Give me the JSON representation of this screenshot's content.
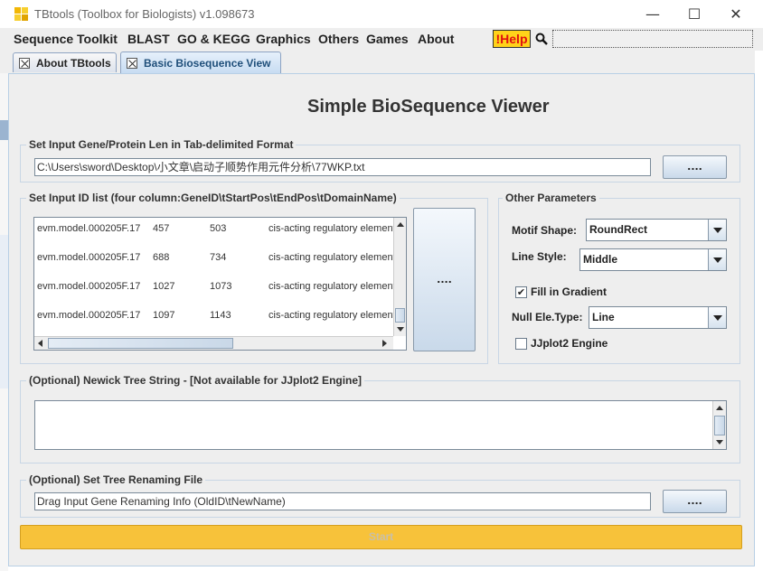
{
  "window": {
    "title": "TBtools (Toolbox for Biologists) v1.098673",
    "minimize": "—",
    "maximize": "☐",
    "close": "✕"
  },
  "menubar": {
    "items": [
      "Sequence Toolkit",
      "BLAST",
      "GO & KEGG",
      "Graphics",
      "Others",
      "Games",
      "About"
    ],
    "help_label": "!Help",
    "search_value": ""
  },
  "tabs": [
    {
      "label": "About TBtools",
      "active": false
    },
    {
      "label": "Basic Biosequence View",
      "active": true
    }
  ],
  "main": {
    "title": "Simple BioSequence Viewer",
    "gene_len_group": {
      "title": "Set Input Gene/Protein Len in Tab-delimited Format",
      "path": "C:\\Users\\sword\\Desktop\\小文章\\启动子顺势作用元件分析\\77WKP.txt",
      "browse_label": "...."
    },
    "id_list_group": {
      "title": "Set Input ID list (four column:GeneID\\tStartPos\\tEndPos\\tDomainName)",
      "rows": [
        {
          "id": "evm.model.000205F.17",
          "start": "457",
          "end": "503",
          "name": "cis-acting regulatory element"
        },
        {
          "id": "evm.model.000205F.17",
          "start": "688",
          "end": "734",
          "name": "cis-acting regulatory element"
        },
        {
          "id": "evm.model.000205F.17",
          "start": "1027",
          "end": "1073",
          "name": "cis-acting regulatory element"
        },
        {
          "id": "evm.model.000205F.17",
          "start": "1097",
          "end": "1143",
          "name": "cis-acting regulatory element"
        }
      ],
      "browse_label": "...."
    },
    "other_params": {
      "title": "Other Parameters",
      "motif_shape_label": "Motif Shape:",
      "motif_shape_value": "RoundRect",
      "line_style_label": "Line Style:",
      "line_style_value": "Middle",
      "fill_gradient_label": "Fill in Gradient",
      "fill_gradient_checked": true,
      "null_ele_label": "Null Ele.Type:",
      "null_ele_value": "Line",
      "jjplot_label": "JJplot2 Engine",
      "jjplot_checked": false
    },
    "newick_group": {
      "title": "(Optional) Newick Tree String - [Not available for JJplot2 Engine]",
      "value": ""
    },
    "rename_group": {
      "title": "(Optional) Set Tree Renaming File",
      "value": "Drag Input Gene Renaming Info (OldID\\tNewName)",
      "browse_label": "...."
    },
    "start_label": "Start"
  },
  "colors": {
    "accent": "#f7c23a",
    "help_bg": "#ffd21a",
    "help_text": "#e01010",
    "tab_active": "#c7dcf2"
  }
}
